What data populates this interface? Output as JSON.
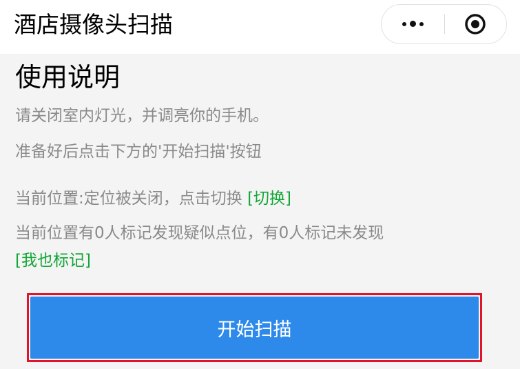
{
  "app": {
    "title": "酒店摄像头扫描"
  },
  "capsule": {
    "more_icon": "more-dots-icon",
    "close_icon": "target-circle-icon"
  },
  "instructions": {
    "heading": "使用说明",
    "line1": "请关闭室内灯光，并调亮你的手机。",
    "line2": "准备好后点击下方的'开始扫描'按钮"
  },
  "location": {
    "status_text": "当前位置:定位被关闭，点击切换 ",
    "switch_link": "[切换]",
    "stats_text": "当前位置有0人标记发现疑似点位，有0人标记未发现",
    "mark_link": "[我也标记]"
  },
  "actions": {
    "scan_label": "开始扫描"
  },
  "colors": {
    "link": "#12a537",
    "button": "#2d89ea",
    "highlight_border": "#e1142a"
  }
}
